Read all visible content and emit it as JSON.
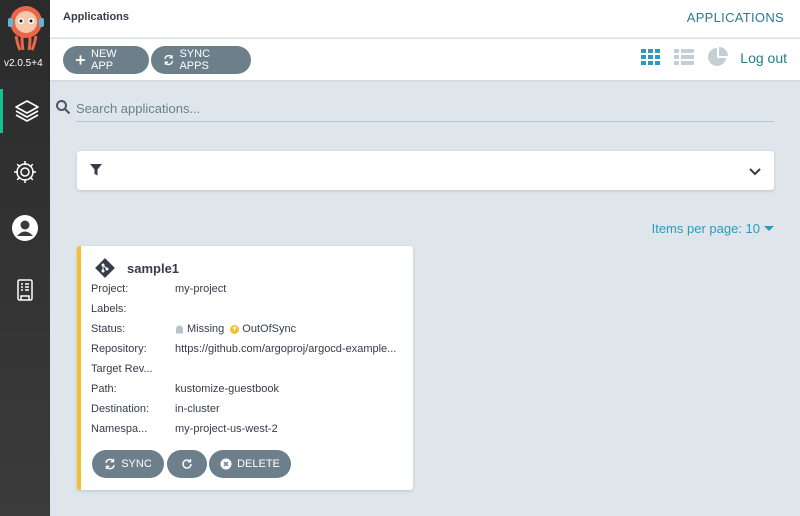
{
  "sidebar": {
    "version": "v2.0.5+4",
    "items": [
      {
        "icon": "layers-icon"
      },
      {
        "icon": "gear-icon"
      },
      {
        "icon": "user-icon"
      },
      {
        "icon": "docs-icon"
      }
    ]
  },
  "topbar": {
    "title": "Applications",
    "section_title": "APPLICATIONS"
  },
  "toolbar": {
    "new_app_label": "NEW APP",
    "sync_apps_label": "SYNC APPS",
    "logout_label": "Log out",
    "view_icons": [
      "tiles-view-icon",
      "list-view-icon",
      "summary-pie-icon"
    ]
  },
  "search": {
    "placeholder": "Search applications..."
  },
  "pagination": {
    "items_per_page": "Items per page: 10"
  },
  "app_card": {
    "name": "sample1",
    "fields": [
      {
        "key": "Project:",
        "value": "my-project"
      },
      {
        "key": "Labels:",
        "value": ""
      },
      {
        "key": "Status:",
        "health": "Missing",
        "sync": "OutOfSync"
      },
      {
        "key": "Repository:",
        "value": "https://github.com/argoproj/argocd-example..."
      },
      {
        "key": "Target Rev...",
        "value": ""
      },
      {
        "key": "Path:",
        "value": "kustomize-guestbook"
      },
      {
        "key": "Destination:",
        "value": "in-cluster"
      },
      {
        "key": "Namespa...",
        "value": "my-project-us-west-2"
      }
    ],
    "sync_label": "SYNC",
    "delete_label": "DELETE"
  },
  "colors": {
    "accent": "#2c7a8f",
    "button": "#6d7f8b",
    "out_of_sync": "#f4c030",
    "background": "#dee6eb"
  }
}
